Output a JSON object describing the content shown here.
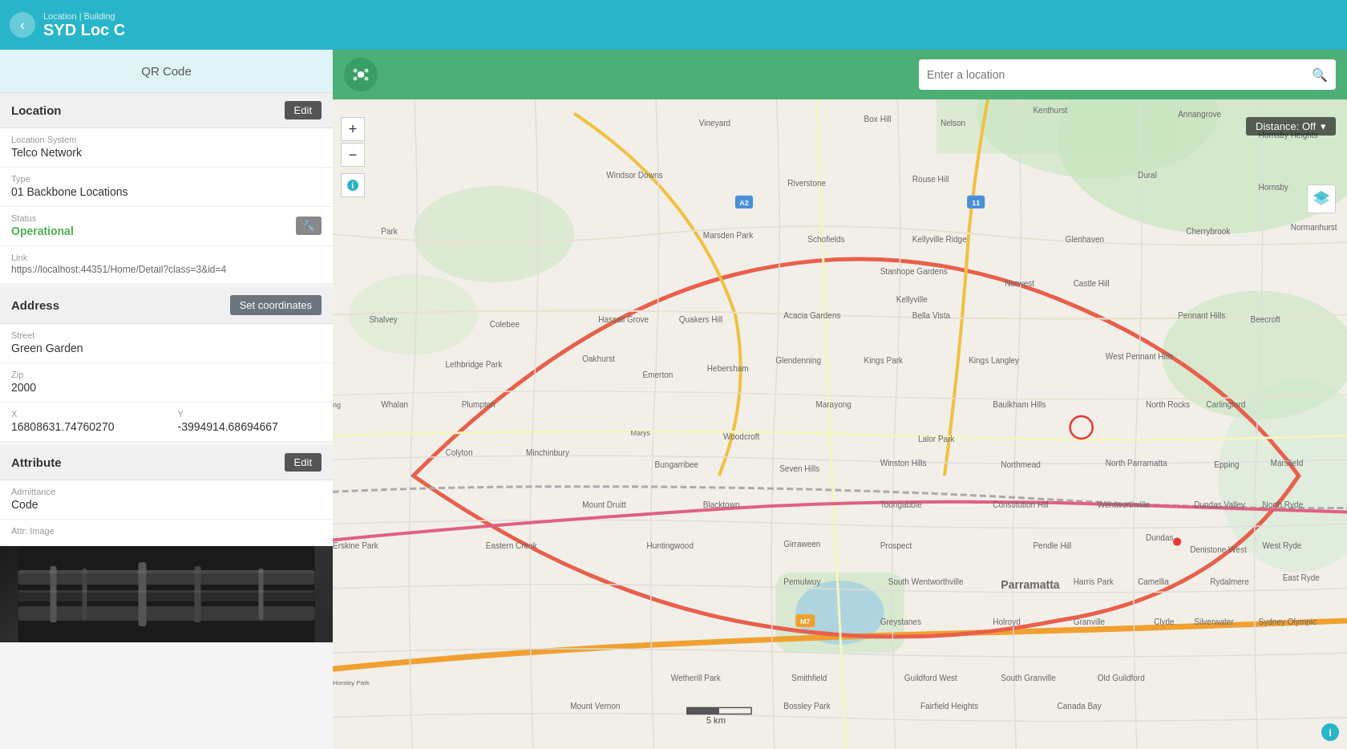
{
  "header": {
    "back_label": "‹",
    "subtitle": "Location | Building",
    "title": "SYD Loc C"
  },
  "sidebar": {
    "qr_label": "QR Code",
    "location_section": {
      "title": "Location",
      "edit_label": "Edit",
      "location_system_label": "Location System",
      "location_system_value": "Telco Network",
      "type_label": "Type",
      "type_value": "01 Backbone Locations",
      "status_label": "Status",
      "status_value": "Operational",
      "link_label": "Link",
      "link_value": "https://localhost:44351/Home/Detail?class=3&id=4"
    },
    "address_section": {
      "title": "Address",
      "set_coords_label": "Set coordinates",
      "street_label": "Street",
      "street_value": "Green Garden",
      "zip_label": "Zip",
      "zip_value": "2000",
      "x_label": "X",
      "x_value": "16808631.74760270",
      "y_label": "Y",
      "y_value": "-3994914.68694667"
    },
    "attribute_section": {
      "title": "Attribute",
      "edit_label": "Edit",
      "admittance_label": "Admittance",
      "admittance_value": "Code",
      "attr_image_label": "Attr: Image"
    }
  },
  "map": {
    "search_placeholder": "Enter a location",
    "distance_label": "Distance: Off",
    "zoom_in": "+",
    "zoom_out": "−",
    "scale_label": "5 km",
    "info_label": "i"
  }
}
